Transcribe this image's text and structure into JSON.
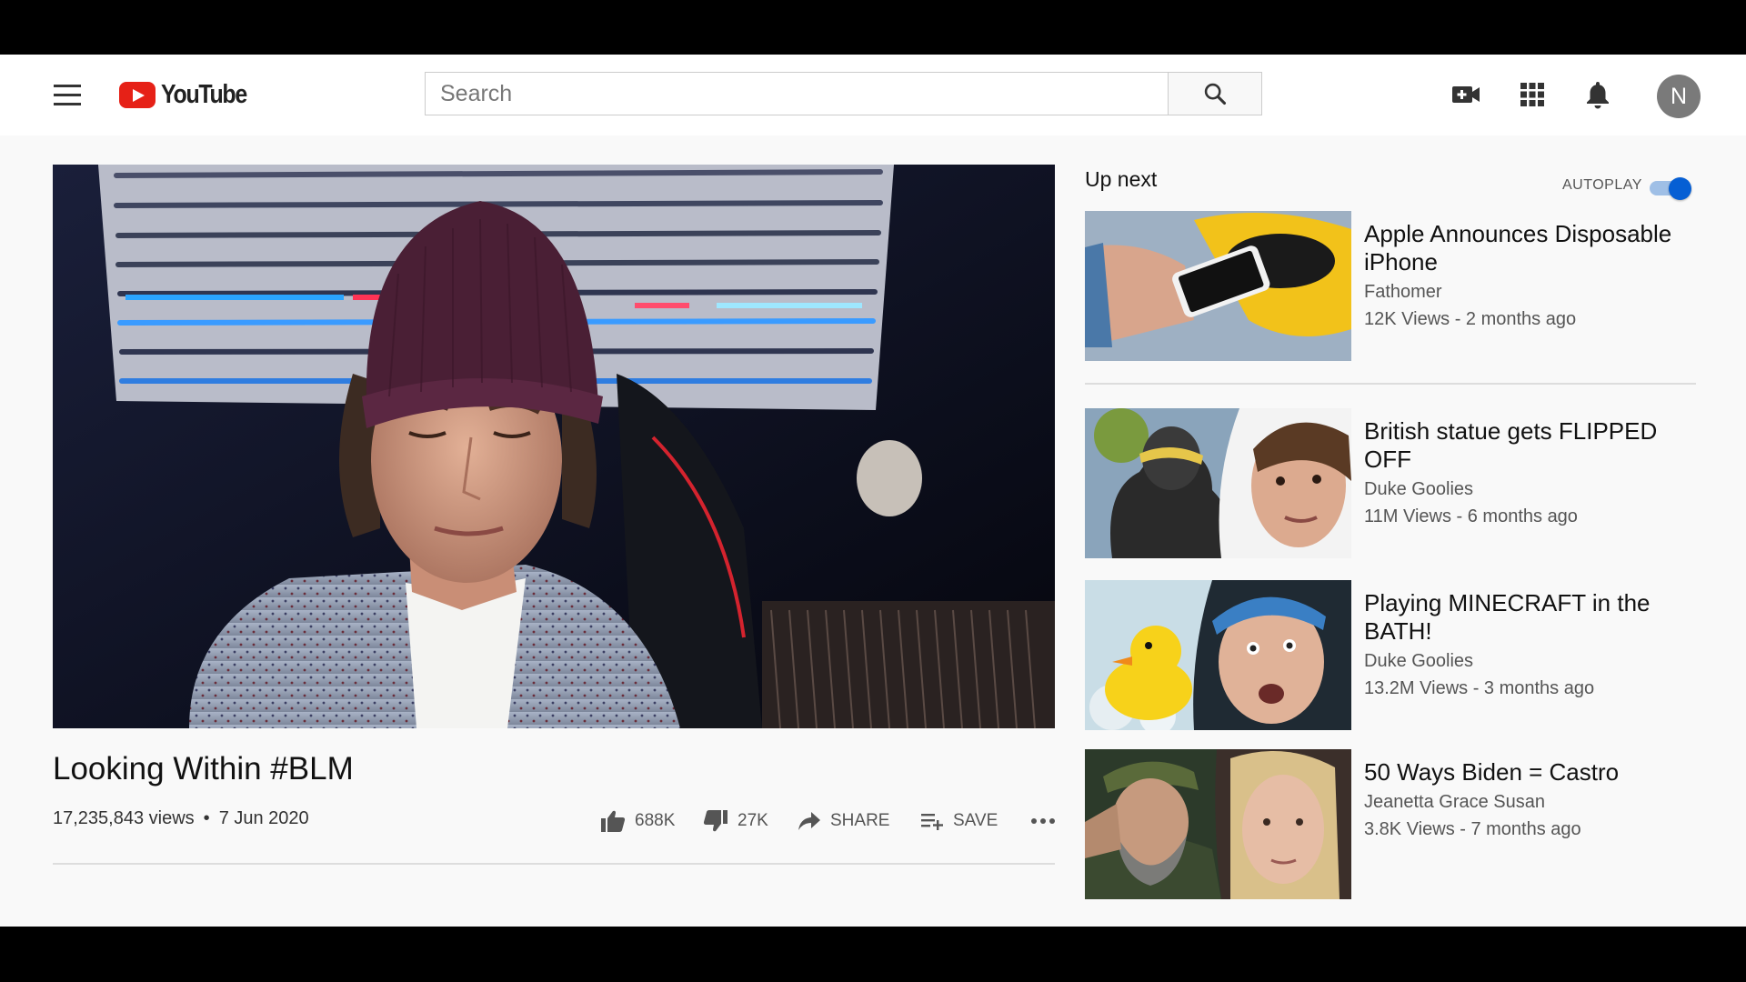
{
  "header": {
    "logo_text": "YouTube",
    "search_placeholder": "Search",
    "avatar_initial": "N"
  },
  "video": {
    "title": "Looking Within #BLM",
    "views": "17,235,843 views",
    "date": "7 Jun 2020",
    "likes": "688K",
    "dislikes": "27K",
    "share_label": "SHARE",
    "save_label": "SAVE"
  },
  "sidebar": {
    "up_next": "Up next",
    "autoplay_label": "AUTOPLAY",
    "autoplay_on": true,
    "items": [
      {
        "title": "Apple Announces Disposable iPhone",
        "channel": "Fathomer",
        "stats": "12K Views - 2 months ago"
      },
      {
        "title": "British statue gets FLIPPED OFF",
        "channel": "Duke Goolies",
        "stats": "11M Views - 6 months ago"
      },
      {
        "title": "Playing MINECRAFT in the BATH!",
        "channel": "Duke Goolies",
        "stats": "13.2M Views - 3 months ago"
      },
      {
        "title": "50 Ways Biden = Castro",
        "channel": "Jeanetta Grace Susan",
        "stats": "3.8K Views - 7 months ago"
      }
    ]
  },
  "colors": {
    "accent": "#065fd4",
    "brand_red": "#e62117",
    "background": "#f9f9f9"
  }
}
